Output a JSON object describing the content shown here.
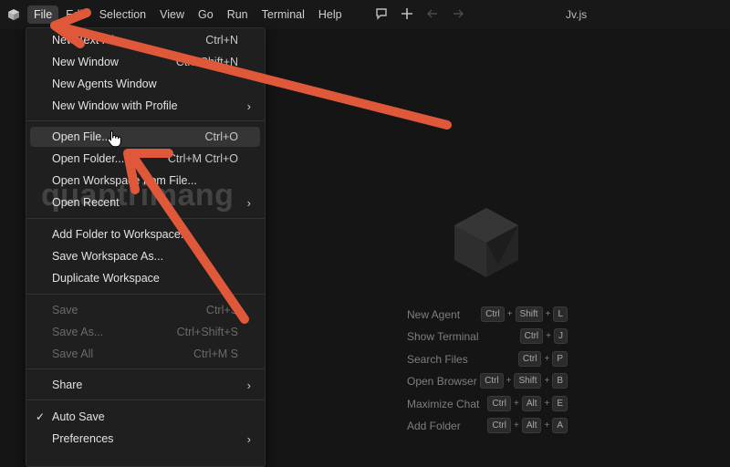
{
  "menubar": {
    "items": [
      "File",
      "Edit",
      "Selection",
      "View",
      "Go",
      "Run",
      "Terminal",
      "Help"
    ]
  },
  "window": {
    "title": "Jv.js"
  },
  "file_menu": {
    "groups": [
      [
        {
          "label": "New Text File",
          "shortcut": "Ctrl+N"
        },
        {
          "label": "New Window",
          "shortcut": "Ctrl+Shift+N"
        },
        {
          "label": "New Agents Window",
          "shortcut": ""
        },
        {
          "label": "New Window with Profile",
          "shortcut": "",
          "submenu": true
        }
      ],
      [
        {
          "label": "Open File...",
          "shortcut": "Ctrl+O",
          "highlighted": true
        },
        {
          "label": "Open Folder...",
          "shortcut": "Ctrl+M Ctrl+O"
        },
        {
          "label": "Open Workspace from File...",
          "shortcut": ""
        },
        {
          "label": "Open Recent",
          "shortcut": "",
          "submenu": true
        }
      ],
      [
        {
          "label": "Add Folder to Workspace...",
          "shortcut": ""
        },
        {
          "label": "Save Workspace As...",
          "shortcut": ""
        },
        {
          "label": "Duplicate Workspace",
          "shortcut": ""
        }
      ],
      [
        {
          "label": "Save",
          "shortcut": "Ctrl+S",
          "disabled": true
        },
        {
          "label": "Save As...",
          "shortcut": "Ctrl+Shift+S",
          "disabled": true
        },
        {
          "label": "Save All",
          "shortcut": "Ctrl+M S",
          "disabled": true
        }
      ],
      [
        {
          "label": "Share",
          "shortcut": "",
          "submenu": true
        }
      ],
      [
        {
          "label": "Auto Save",
          "shortcut": "",
          "checked": true
        },
        {
          "label": "Preferences",
          "shortcut": "",
          "submenu": true
        }
      ]
    ]
  },
  "watermark": "quantrimang",
  "shortcuts": [
    {
      "name": "New Agent",
      "keys": [
        "Ctrl",
        "Shift",
        "L"
      ]
    },
    {
      "name": "Show Terminal",
      "keys": [
        "Ctrl",
        "J"
      ]
    },
    {
      "name": "Search Files",
      "keys": [
        "Ctrl",
        "P"
      ]
    },
    {
      "name": "Open Browser",
      "keys": [
        "Ctrl",
        "Shift",
        "B"
      ]
    },
    {
      "name": "Maximize Chat",
      "keys": [
        "Ctrl",
        "Alt",
        "E"
      ]
    },
    {
      "name": "Add Folder",
      "keys": [
        "Ctrl",
        "Alt",
        "A"
      ]
    }
  ],
  "icons": {
    "app": "app-cube-icon",
    "chat": "chat-icon",
    "add": "plus-icon",
    "back": "arrow-left-icon",
    "forward": "arrow-right-icon",
    "cursor": "hand-pointer-icon"
  },
  "colors": {
    "annotation_arrow": "#e0583a",
    "menu_highlight": "#353535"
  }
}
